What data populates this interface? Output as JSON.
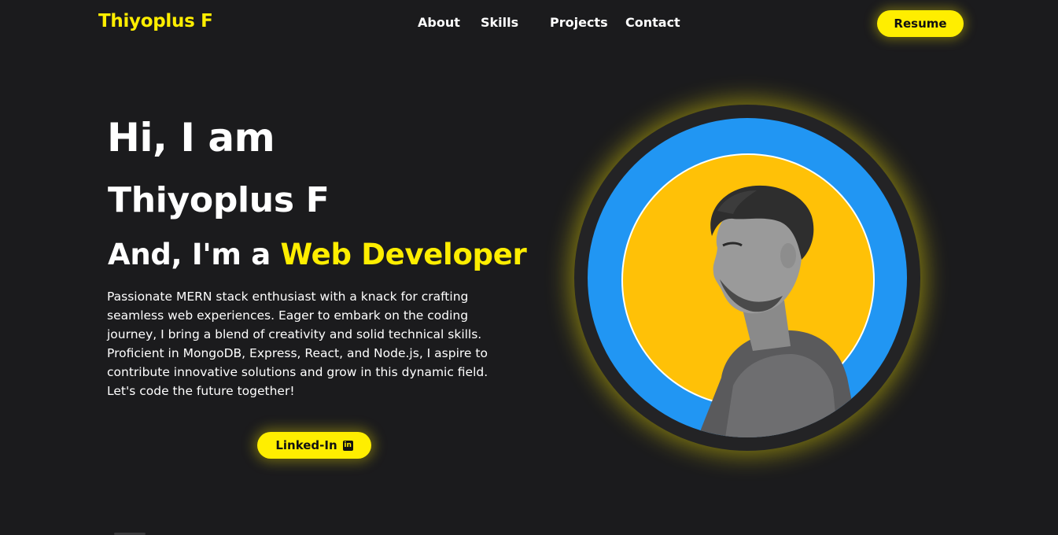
{
  "brand": {
    "name": "Thiyoplus F"
  },
  "nav": {
    "items": [
      {
        "label": "About"
      },
      {
        "label": "Skills"
      },
      {
        "label": "Projects"
      },
      {
        "label": "Contact"
      }
    ],
    "resume_label": "Resume"
  },
  "hero": {
    "greeting": "Hi, I am",
    "name": "Thiyoplus F",
    "role_prefix": "And, I'm a ",
    "role_highlight": "Web Developer",
    "bio": "Passionate MERN stack enthusiast with a knack for crafting seamless web experiences. Eager to embark on the coding journey, I bring a blend of creativity and solid technical skills. Proficient in MongoDB, Express, React, and Node.js, I aspire to contribute innovative solutions and grow in this dynamic field. Let's code the future together!",
    "linkedin_label": "Linked-In",
    "linkedin_icon": "linkedin-icon"
  },
  "avatar": {
    "ring_color": "#2196f3",
    "inner_color": "#ffc107",
    "glow_color": "#ffee00"
  },
  "colors": {
    "accent": "#ffee00",
    "background": "#1b1b1d",
    "text": "#ffffff"
  }
}
